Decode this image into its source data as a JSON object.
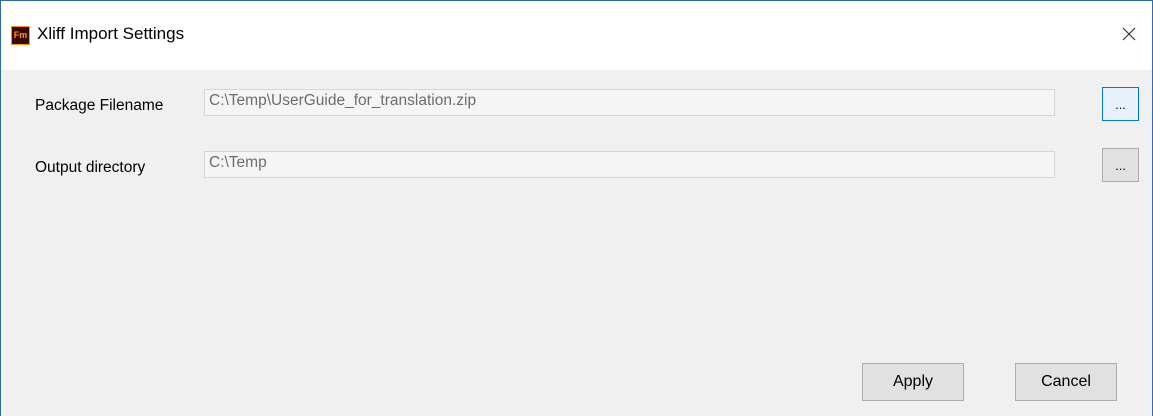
{
  "window": {
    "title": "Xliff Import Settings",
    "app_icon_text": "Fm"
  },
  "form": {
    "package_filename": {
      "label": "Package Filename",
      "value": "C:\\Temp\\UserGuide_for_translation.zip",
      "browse_label": "..."
    },
    "output_directory": {
      "label": "Output directory",
      "value": "C:\\Temp",
      "browse_label": "..."
    }
  },
  "buttons": {
    "apply": "Apply",
    "cancel": "Cancel"
  }
}
